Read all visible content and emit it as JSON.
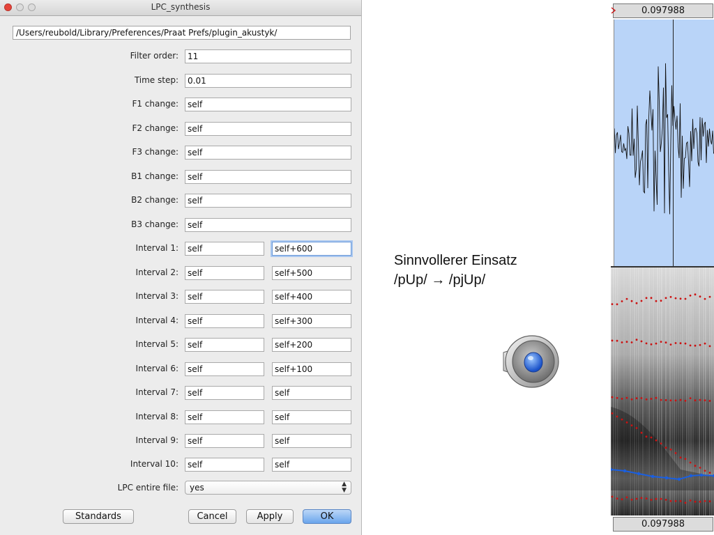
{
  "dialog": {
    "title": "LPC_synthesis",
    "path": "/Users/reubold/Library/Preferences/Praat Prefs/plugin_akustyk/",
    "fields": [
      {
        "label": "Filter order:",
        "value": "11"
      },
      {
        "label": "Time step:",
        "value": "0.01"
      },
      {
        "label": "F1 change:",
        "value": "self"
      },
      {
        "label": "F2 change:",
        "value": "self"
      },
      {
        "label": "F3 change:",
        "value": "self"
      },
      {
        "label": "B1 change:",
        "value": "self"
      },
      {
        "label": "B2 change:",
        "value": "self"
      },
      {
        "label": "B3 change:",
        "value": "self"
      }
    ],
    "intervals": [
      {
        "label": "Interval 1:",
        "from": "self",
        "to": "self+600"
      },
      {
        "label": "Interval 2:",
        "from": "self",
        "to": "self+500"
      },
      {
        "label": "Interval 3:",
        "from": "self",
        "to": "self+400"
      },
      {
        "label": "Interval 4:",
        "from": "self",
        "to": "self+300"
      },
      {
        "label": "Interval 5:",
        "from": "self",
        "to": "self+200"
      },
      {
        "label": "Interval 6:",
        "from": "self",
        "to": "self+100"
      },
      {
        "label": "Interval 7:",
        "from": "self",
        "to": "self"
      },
      {
        "label": "Interval 8:",
        "from": "self",
        "to": "self"
      },
      {
        "label": "Interval 9:",
        "from": "self",
        "to": "self"
      },
      {
        "label": "Interval 10:",
        "from": "self",
        "to": "self"
      }
    ],
    "lpc_label": "LPC entire file:",
    "lpc_value": "yes",
    "buttons": {
      "standards": "Standards",
      "cancel": "Cancel",
      "apply": "Apply",
      "ok": "OK"
    }
  },
  "slide": {
    "line1": "Sinnvollerer Einsatz",
    "line2": "/pUp/ → /pjUp/"
  },
  "editor": {
    "time_top": "0.097988",
    "time_bottom": "0.097988"
  },
  "icons": [
    "speaker-icon",
    "close-window-icon",
    "minimize-window-icon",
    "zoom-window-icon",
    "updown-arrows-icon"
  ],
  "colors": {
    "selection": "#b9d4f8",
    "formant_dots": "#cc1111",
    "pitch_line": "#1a5fe0",
    "default_button": "#6aa5ec"
  }
}
